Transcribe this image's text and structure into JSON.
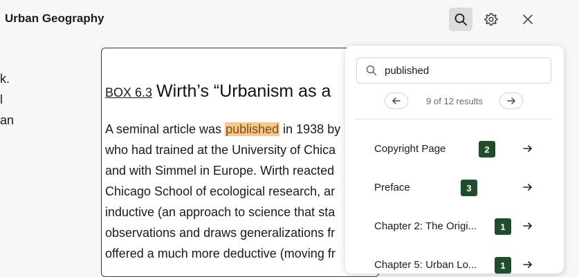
{
  "header": {
    "book_title": "Urban Geography"
  },
  "icons": {
    "search": "search-icon",
    "settings": "gear-icon",
    "close": "close-icon"
  },
  "left_fragment": [
    "k.",
    "l",
    "an"
  ],
  "page": {
    "box_label": "BOX 6.3",
    "box_title": "Wirth’s “Urbanism as a",
    "lines": [
      {
        "before": "A seminal article was ",
        "highlight": "published",
        "after": " in 1938 by"
      },
      {
        "before": "who had trained at the University of Chica",
        "highlight": "",
        "after": ""
      },
      {
        "before": "and with Simmel in Europe. Wirth reacted",
        "highlight": "",
        "after": ""
      },
      {
        "before": "Chicago School of ecological research, ar",
        "highlight": "",
        "after": ""
      },
      {
        "before": "inductive (an approach to science that sta",
        "highlight": "",
        "after": ""
      },
      {
        "before": "observations and draws generalizations fr",
        "highlight": "",
        "after": ""
      },
      {
        "before": "offered a much more deductive (moving fr",
        "highlight": "",
        "after": ""
      }
    ]
  },
  "search_panel": {
    "query": "published",
    "result_count": "9 of 12 results",
    "results": [
      {
        "label": "Copyright Page",
        "count": "2"
      },
      {
        "label": "Preface",
        "count": "3"
      },
      {
        "label": "Chapter 2: The Origi...",
        "count": "1"
      },
      {
        "label": "Chapter 5: Urban Lo...",
        "count": "1"
      }
    ]
  },
  "colors": {
    "highlight": "#f8c98a",
    "badge": "#1f4d2b",
    "active_icon_bg": "#dcdcdc"
  }
}
